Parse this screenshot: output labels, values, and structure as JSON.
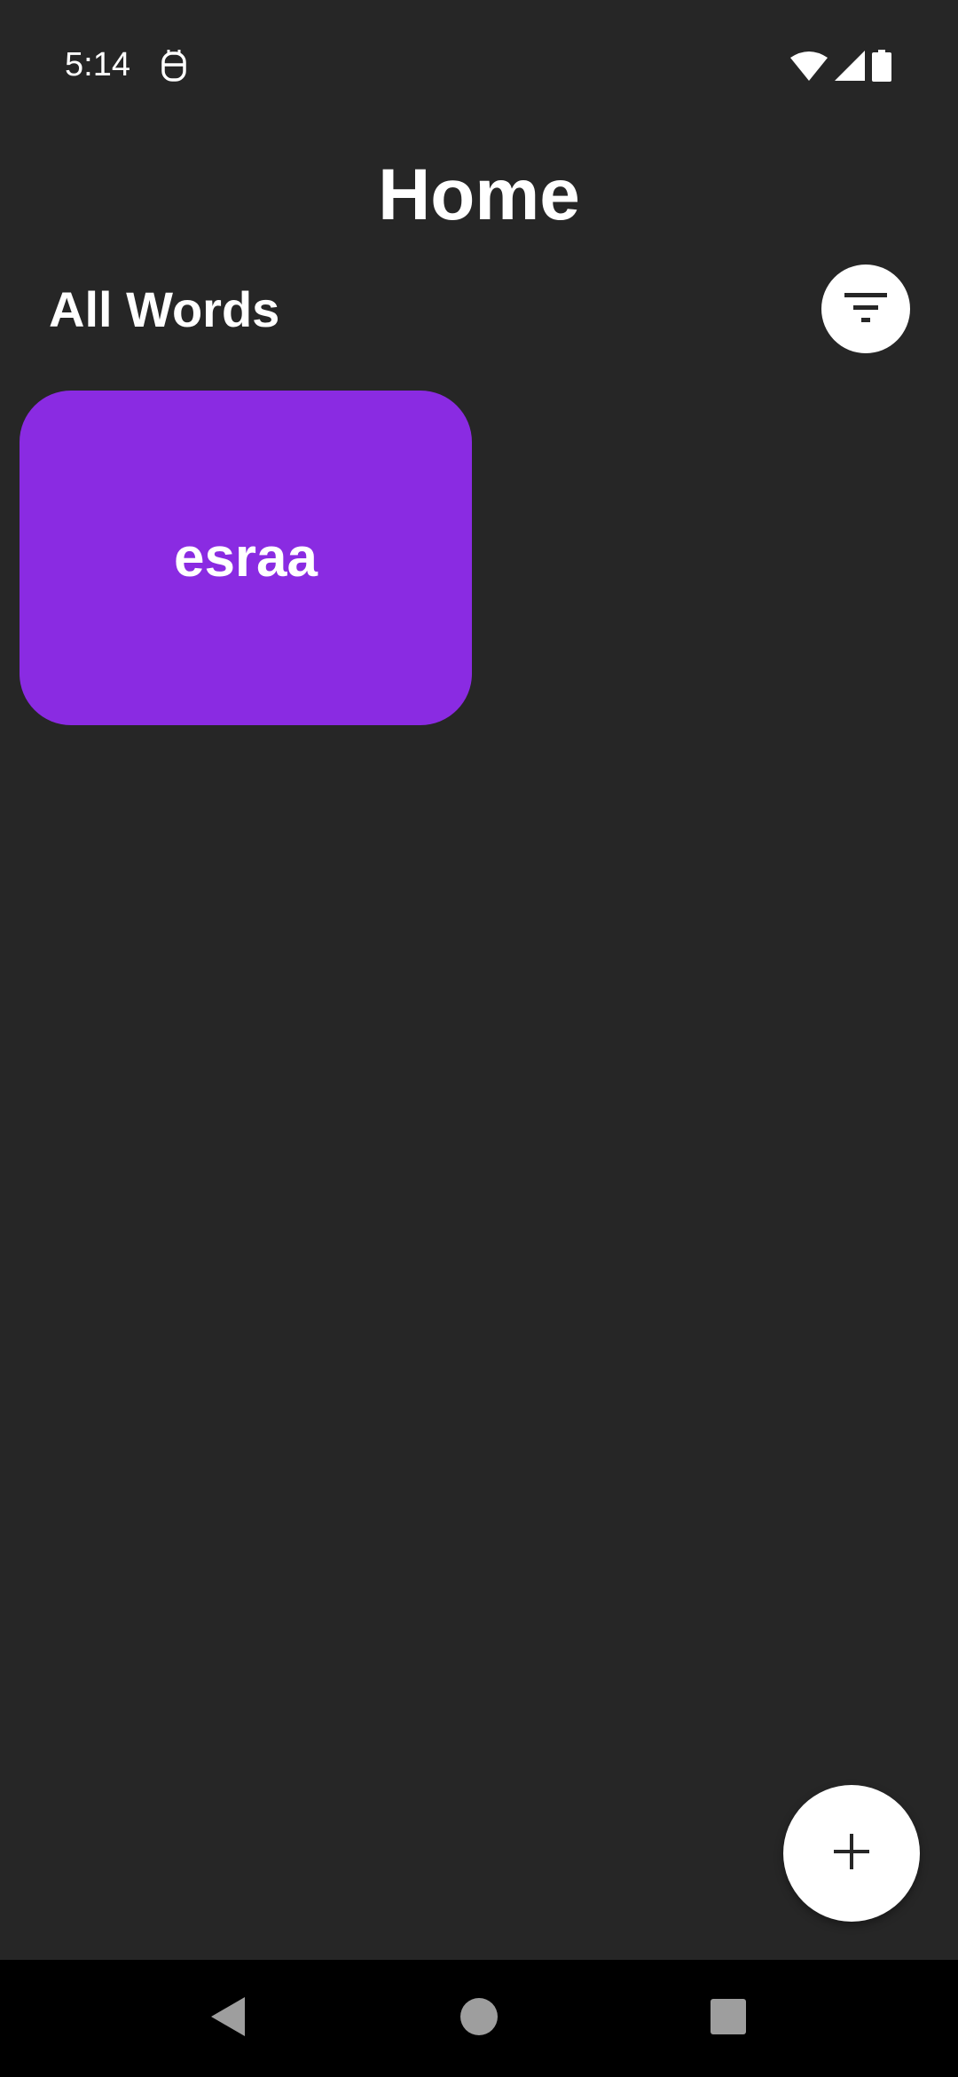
{
  "status_bar": {
    "time": "5:14",
    "icons": [
      "notification-icon",
      "wifi-icon",
      "cell-signal-icon",
      "battery-icon"
    ]
  },
  "header": {
    "title": "Home"
  },
  "section": {
    "title": "All Words",
    "filter_icon": "filter-icon"
  },
  "words": [
    {
      "label": "esraa",
      "color": "#8A2BE2"
    }
  ],
  "fab": {
    "icon": "plus-icon"
  },
  "nav_bar": {
    "icons": [
      "back-icon",
      "home-icon",
      "recents-icon"
    ]
  },
  "colors": {
    "background": "#262626",
    "card": "#8A2BE2",
    "button_bg": "#FFFFFF",
    "nav_bg": "#000000"
  }
}
